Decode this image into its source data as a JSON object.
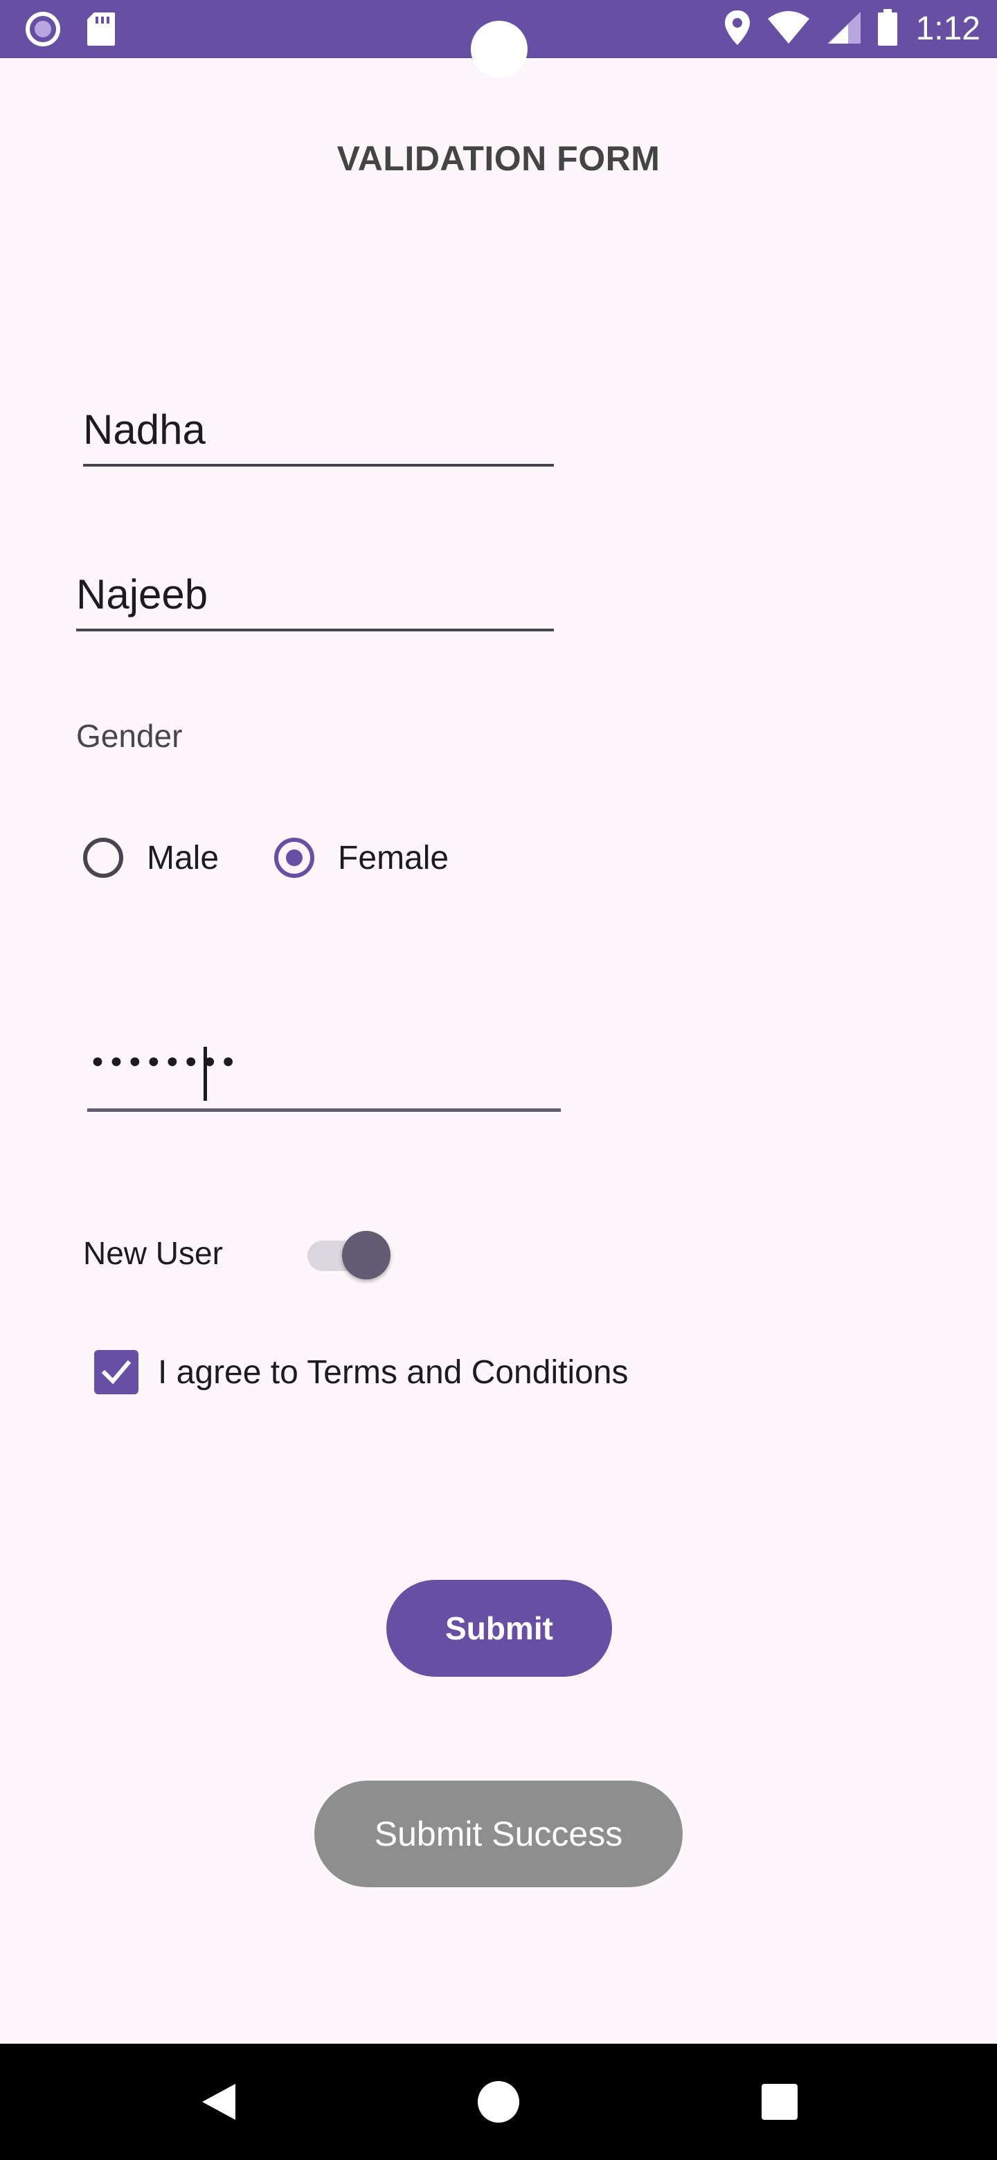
{
  "status_bar": {
    "time": "1:12",
    "bg_color": "#6750a4",
    "left_icons": [
      "record-icon",
      "sd-card-icon"
    ],
    "right_icons": [
      "location-icon",
      "wifi-icon",
      "signal-icon",
      "battery-icon"
    ]
  },
  "form": {
    "title": "VALIDATION FORM",
    "first_name": {
      "value": "Nadha",
      "placeholder": ""
    },
    "last_name": {
      "value": "Najeeb",
      "placeholder": ""
    },
    "gender": {
      "label": "Gender",
      "options": [
        {
          "label": "Male",
          "selected": false
        },
        {
          "label": "Female",
          "selected": true
        }
      ]
    },
    "password": {
      "masked_value": "••••••••",
      "focused": true
    },
    "new_user": {
      "label": "New User",
      "on": true
    },
    "terms": {
      "label": "I agree to Terms and Conditions",
      "checked": true
    },
    "submit_label": "Submit",
    "toast": "Submit Success"
  },
  "colors": {
    "accent": "#6750a4",
    "background": "#fdf7fc",
    "toast_bg": "#8e8e8e"
  },
  "nav_bar": {
    "buttons": [
      "back-icon",
      "home-icon",
      "recents-icon"
    ]
  }
}
